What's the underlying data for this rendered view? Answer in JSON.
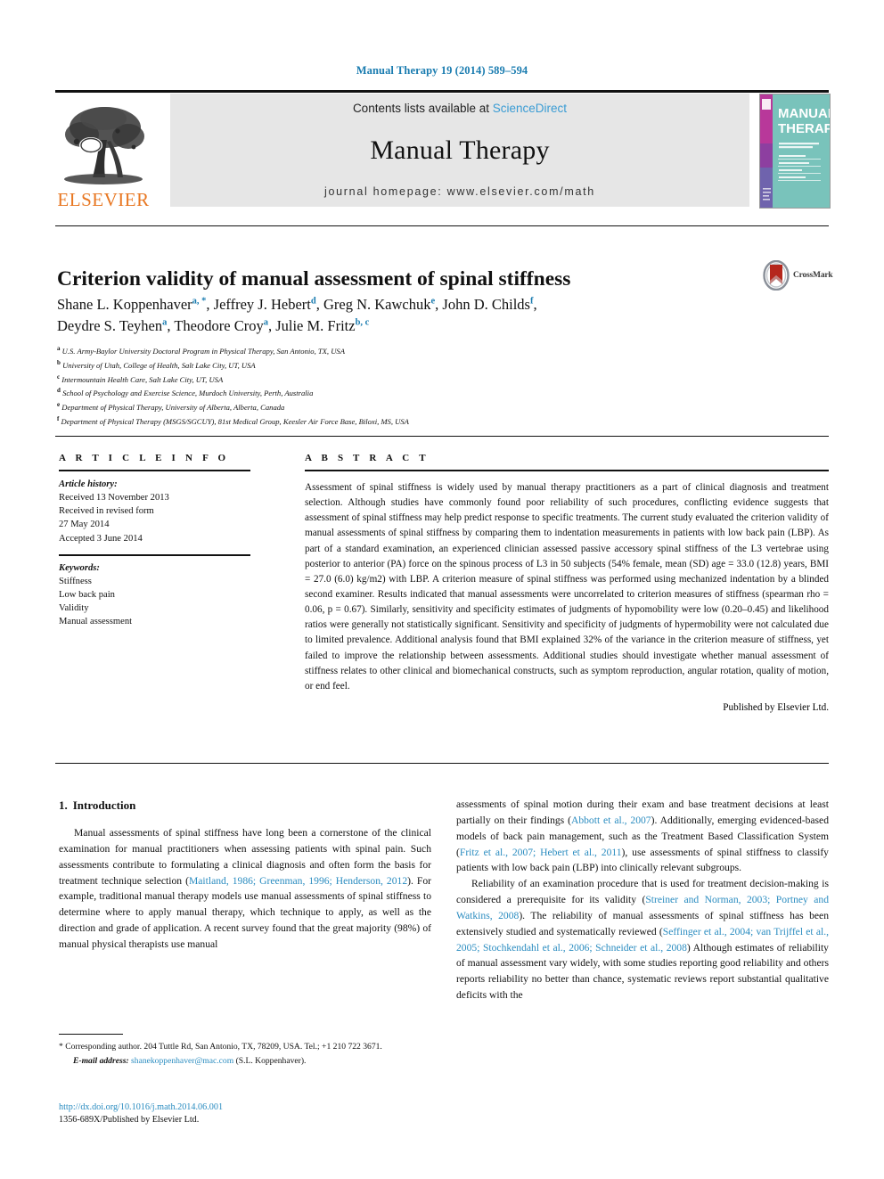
{
  "running_head": "Manual Therapy 19 (2014) 589–594",
  "masthead": {
    "contents_prefix": "Contents lists available at ",
    "sciencedirect": "ScienceDirect",
    "journal_name": "Manual Therapy",
    "homepage": "journal homepage: www.elsevier.com/math",
    "publisher_wordmark": "ELSEVIER",
    "cover": {
      "line1": "MANUAL",
      "line2": "THERAPY",
      "accent_color": "#79c3bb",
      "spine_color": "#c0389a"
    }
  },
  "article": {
    "title": "Criterion validity of manual assessment of spinal stiffness",
    "crossmark_label": "CrossMark",
    "authors_line1": "Shane L. Koppenhaver a, *, Jeffrey J. Hebert d, Greg N. Kawchuk e, John D. Childs f,",
    "authors_line2": "Deydre S. Teyhen a, Theodore Croy a, Julie M. Fritz b, c",
    "authors": [
      {
        "name": "Shane L. Koppenhaver",
        "marks": "a, *"
      },
      {
        "name": "Jeffrey J. Hebert",
        "marks": "d"
      },
      {
        "name": "Greg N. Kawchuk",
        "marks": "e"
      },
      {
        "name": "John D. Childs",
        "marks": "f"
      },
      {
        "name": "Deydre S. Teyhen",
        "marks": "a"
      },
      {
        "name": "Theodore Croy",
        "marks": "a"
      },
      {
        "name": "Julie M. Fritz",
        "marks": "b, c"
      }
    ],
    "affiliations": [
      {
        "mark": "a",
        "text": "U.S. Army-Baylor University Doctoral Program in Physical Therapy, San Antonio, TX, USA"
      },
      {
        "mark": "b",
        "text": "University of Utah, College of Health, Salt Lake City, UT, USA"
      },
      {
        "mark": "c",
        "text": "Intermountain Health Care, Salt Lake City, UT, USA"
      },
      {
        "mark": "d",
        "text": "School of Psychology and Exercise Science, Murdoch University, Perth, Australia"
      },
      {
        "mark": "e",
        "text": "Department of Physical Therapy, University of Alberta, Alberta, Canada"
      },
      {
        "mark": "f",
        "text": "Department of Physical Therapy (MSGS/SGCUY), 81st Medical Group, Keesler Air Force Base, Biloxi, MS, USA"
      }
    ]
  },
  "article_info": {
    "heading": "A R T I C L E  I N F O",
    "history_label": "Article history:",
    "history": [
      "Received 13 November 2013",
      "Received in revised form",
      "27 May 2014",
      "Accepted 3 June 2014"
    ],
    "keywords_label": "Keywords:",
    "keywords": [
      "Stiffness",
      "Low back pain",
      "Validity",
      "Manual assessment"
    ]
  },
  "abstract": {
    "heading": "A B S T R A C T",
    "text": "Assessment of spinal stiffness is widely used by manual therapy practitioners as a part of clinical diagnosis and treatment selection. Although studies have commonly found poor reliability of such procedures, conflicting evidence suggests that assessment of spinal stiffness may help predict response to specific treatments. The current study evaluated the criterion validity of manual assessments of spinal stiffness by comparing them to indentation measurements in patients with low back pain (LBP). As part of a standard examination, an experienced clinician assessed passive accessory spinal stiffness of the L3 vertebrae using posterior to anterior (PA) force on the spinous process of L3 in 50 subjects (54% female, mean (SD) age = 33.0 (12.8) years, BMI = 27.0 (6.0) kg/m2) with LBP. A criterion measure of spinal stiffness was performed using mechanized indentation by a blinded second examiner. Results indicated that manual assessments were uncorrelated to criterion measures of stiffness (spearman rho = 0.06, p = 0.67). Similarly, sensitivity and specificity estimates of judgments of hypomobility were low (0.20–0.45) and likelihood ratios were generally not statistically significant. Sensitivity and specificity of judgments of hypermobility were not calculated due to limited prevalence. Additional analysis found that BMI explained 32% of the variance in the criterion measure of stiffness, yet failed to improve the relationship between assessments. Additional studies should investigate whether manual assessment of stiffness relates to other clinical and biomechanical constructs, such as symptom reproduction, angular rotation, quality of motion, or end feel.",
    "signature": "Published by Elsevier Ltd."
  },
  "introduction": {
    "number": "1.",
    "heading": "Introduction",
    "left_paragraph": "Manual assessments of spinal stiffness have long been a cornerstone of the clinical examination for manual practitioners when assessing patients with spinal pain. Such assessments contribute to formulating a clinical diagnosis and often form the basis for treatment technique selection (Maitland, 1986; Greenman, 1996; Henderson, 2012). For example, traditional manual therapy models use manual assessments of spinal stiffness to determine where to apply manual therapy, which technique to apply, as well as the direction and grade of application. A recent survey found that the great majority (98%) of manual physical therapists use manual",
    "right_paragraph_1": "assessments of spinal motion during their exam and base treatment decisions at least partially on their findings (Abbott et al., 2007). Additionally, emerging evidenced-based models of back pain management, such as the Treatment Based Classification System (Fritz et al., 2007; Hebert et al., 2011), use assessments of spinal stiffness to classify patients with low back pain (LBP) into clinically relevant subgroups.",
    "right_paragraph_2": "Reliability of an examination procedure that is used for treatment decision-making is considered a prerequisite for its validity (Streiner and Norman, 2003; Portney and Watkins, 2008). The reliability of manual assessments of spinal stiffness has been extensively studied and systematically reviewed (Seffinger et al., 2004; van Trijffel et al., 2005; Stochkendahl et al., 2006; Schneider et al., 2008) Although estimates of reliability of manual assessment vary widely, with some studies reporting good reliability and others reports reliability no better than chance, systematic reviews report substantial qualitative deficits with the"
  },
  "footnote": {
    "corresponding": "* Corresponding author. 204 Tuttle Rd, San Antonio, TX, 78209, USA. Tel.; +1 210 722 3671.",
    "email_label": "E-mail address:",
    "email": "shanekoppenhaver@mac.com",
    "email_owner": "(S.L. Koppenhaver)."
  },
  "document_footer": {
    "doi": "http://dx.doi.org/10.1016/j.math.2014.06.001",
    "issn_line": "1356-689X/Published by Elsevier Ltd."
  },
  "colors": {
    "link": "#2a8cc0",
    "running_head": "#1a7cb0",
    "elsevier_orange": "#e87722",
    "sciencedirect": "#3a9cd4"
  }
}
